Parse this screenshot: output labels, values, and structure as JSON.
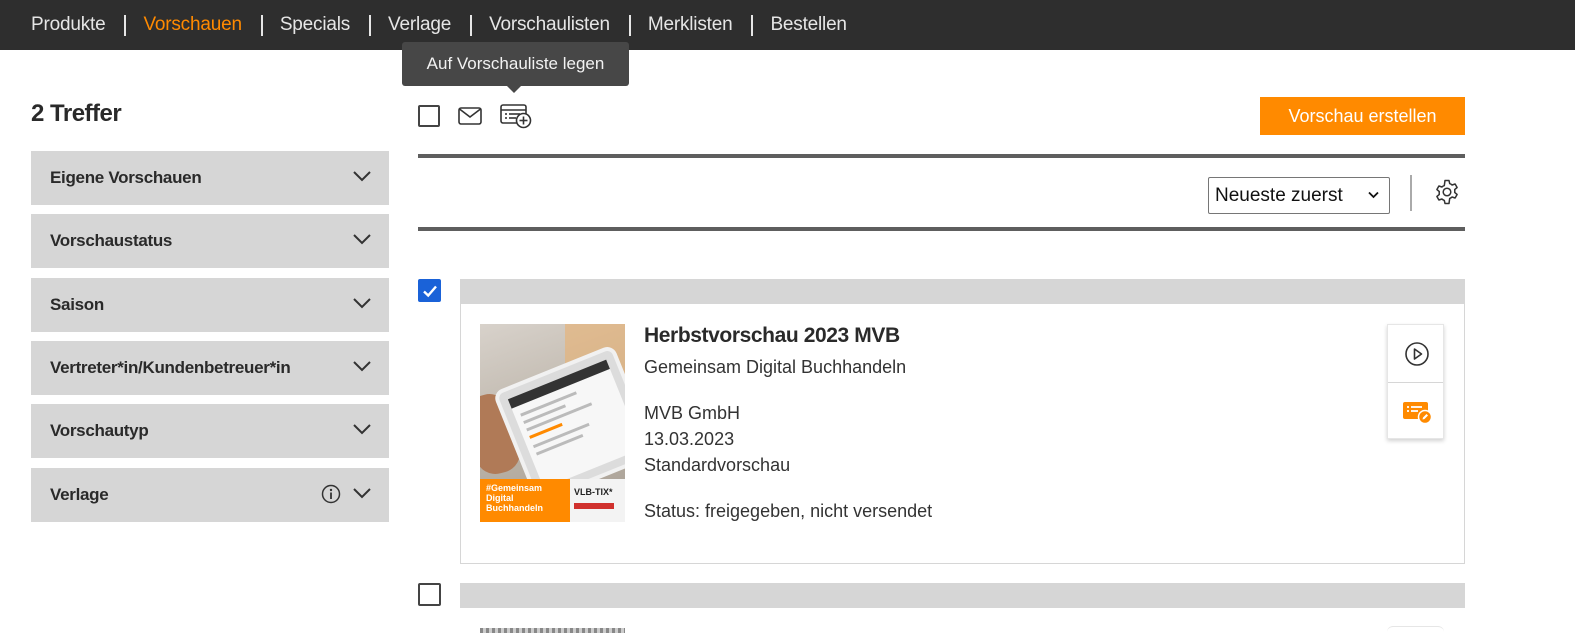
{
  "nav": {
    "items": [
      {
        "label": "Produkte",
        "active": false
      },
      {
        "label": "Vorschauen",
        "active": true
      },
      {
        "label": "Specials",
        "active": false
      },
      {
        "label": "Verlage",
        "active": false
      },
      {
        "label": "Vorschaulisten",
        "active": false
      },
      {
        "label": "Merklisten",
        "active": false
      },
      {
        "label": "Bestellen",
        "active": false
      }
    ]
  },
  "tooltip": {
    "text": "Auf Vorschauliste legen"
  },
  "sidebar": {
    "hits": "2 Treffer",
    "facets": [
      {
        "label": "Eigene Vorschauen"
      },
      {
        "label": "Vorschaustatus"
      },
      {
        "label": "Saison"
      },
      {
        "label": "Vertreter*in/Kundenbetreuer*in"
      },
      {
        "label": "Vorschautyp"
      },
      {
        "label": "Verlage",
        "has_info": true
      }
    ]
  },
  "toolbar": {
    "create_label": "Vorschau erstellen",
    "icons": [
      "checkbox-select-all",
      "mail-icon",
      "add-to-list-icon"
    ]
  },
  "sort": {
    "selected": "Neueste zuerst"
  },
  "results": [
    {
      "checked": true,
      "title": "Herbstvorschau 2023 MVB",
      "subtitle": "Gemeinsam Digital Buchhandeln",
      "publisher": "MVB GmbH",
      "date": "13.03.2023",
      "type": "Standardvorschau",
      "status": "Status: freigegeben, nicht versendet",
      "thumb": {
        "promo_text": "#Gemeinsam Digital Buchhandeln",
        "brand": "VLB-TIX*"
      }
    },
    {
      "checked": false
    }
  ],
  "colors": {
    "accent": "#ff8a00",
    "nav_bg": "#2e2e2e",
    "facet_bg": "#d6d6d6",
    "check_blue": "#1a62d8"
  }
}
